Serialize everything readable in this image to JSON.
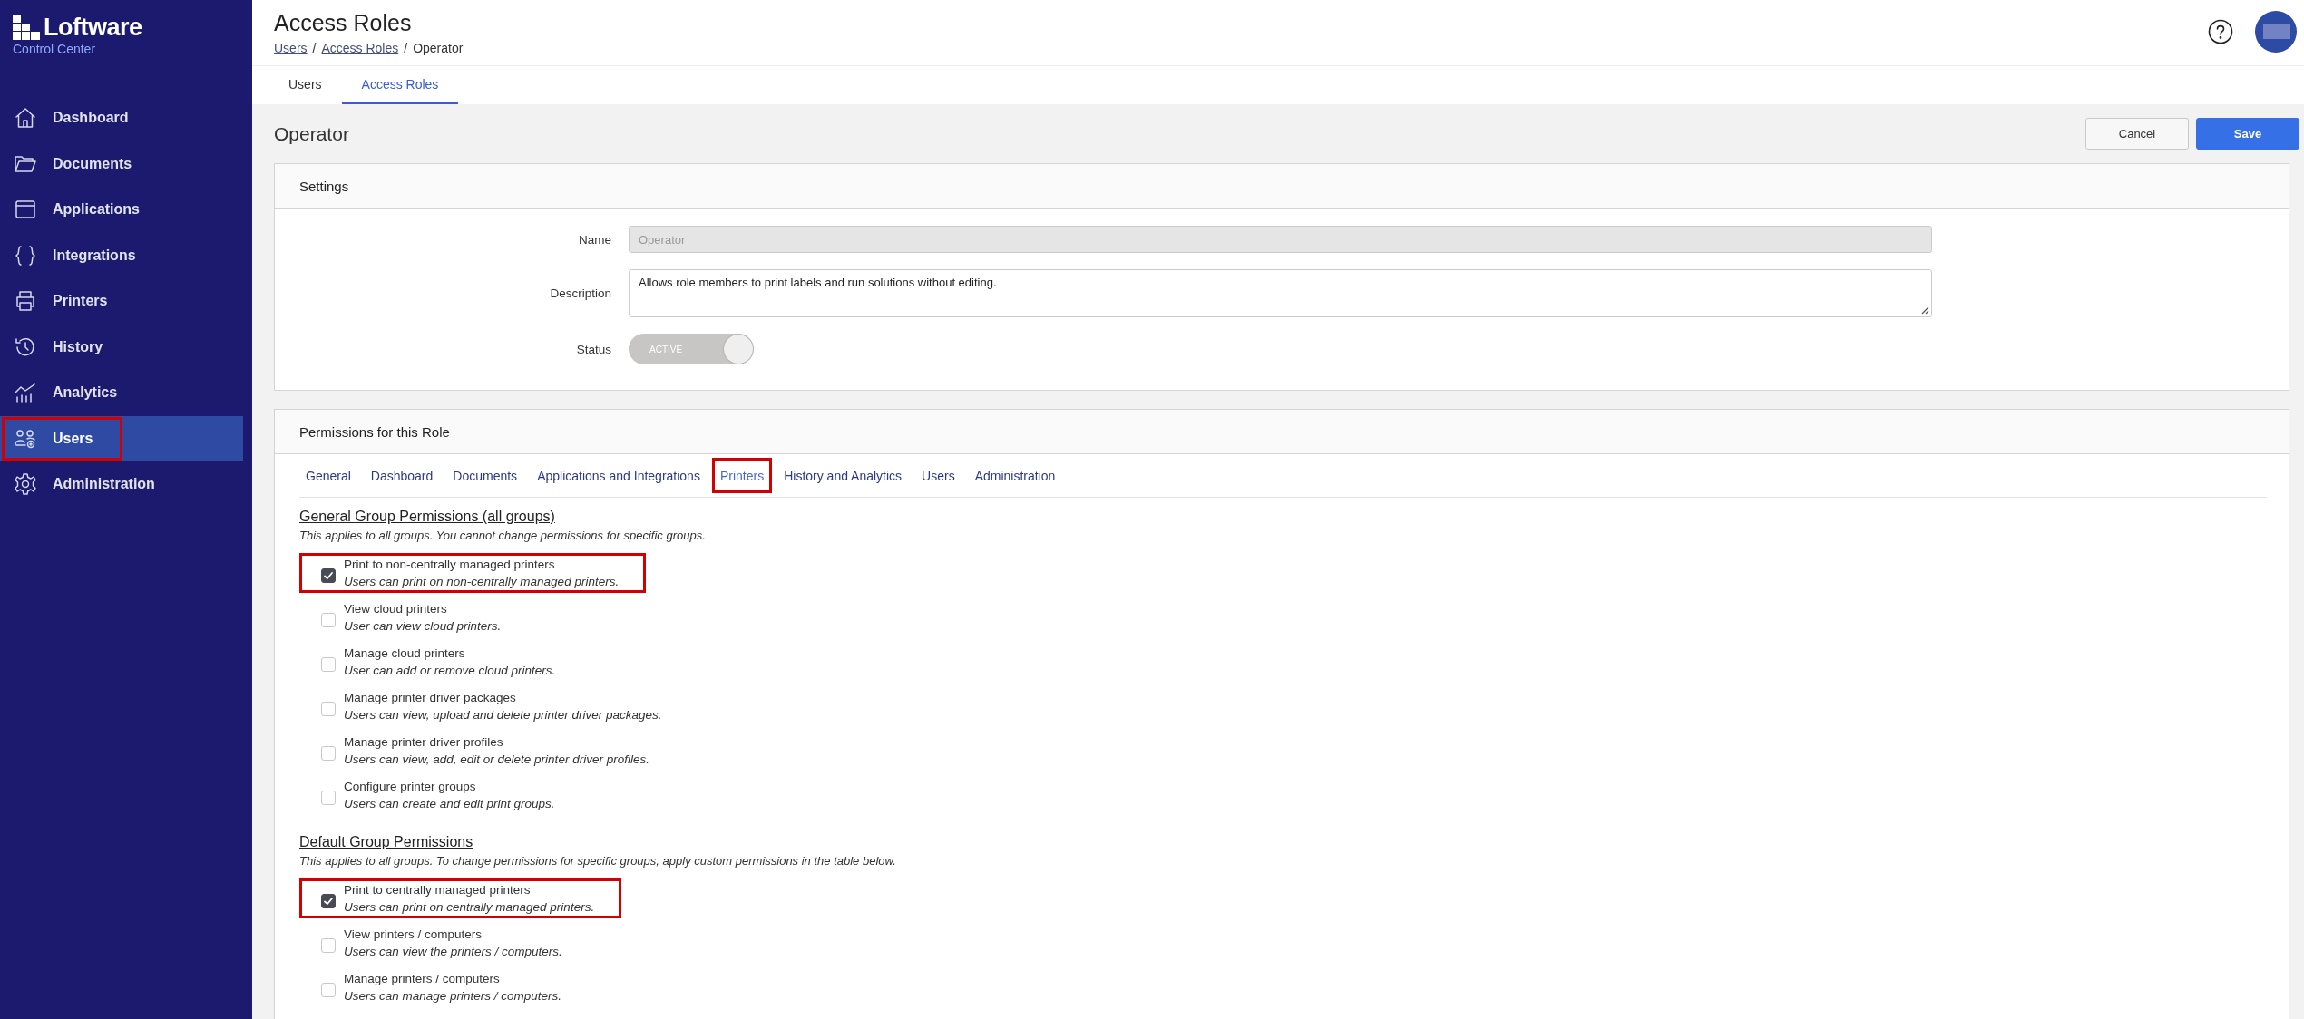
{
  "sidebar": {
    "logo": {
      "name": "Loftware",
      "subtitle": "Control Center"
    },
    "items": [
      {
        "label": "Dashboard",
        "selected": false,
        "highlighted": false
      },
      {
        "label": "Documents",
        "selected": false,
        "highlighted": false
      },
      {
        "label": "Applications",
        "selected": false,
        "highlighted": false
      },
      {
        "label": "Integrations",
        "selected": false,
        "highlighted": false
      },
      {
        "label": "Printers",
        "selected": false,
        "highlighted": false
      },
      {
        "label": "History",
        "selected": false,
        "highlighted": false
      },
      {
        "label": "Analytics",
        "selected": false,
        "highlighted": false
      },
      {
        "label": "Users",
        "selected": true,
        "highlighted": true
      },
      {
        "label": "Administration",
        "selected": false,
        "highlighted": false
      }
    ]
  },
  "header": {
    "title": "Access Roles",
    "breadcrumb": [
      {
        "label": "Users",
        "kind": "link"
      },
      {
        "label": "/",
        "kind": "separator"
      },
      {
        "label": "Access Roles",
        "kind": "link"
      },
      {
        "label": "/",
        "kind": "separator"
      },
      {
        "label": "Operator",
        "kind": "current"
      }
    ]
  },
  "tabs": [
    {
      "label": "Users",
      "selected": false
    },
    {
      "label": "Access Roles",
      "selected": true
    }
  ],
  "page": {
    "title": "Operator",
    "buttons": [
      {
        "label": "Cancel",
        "kind": "secondary"
      },
      {
        "label": "Save",
        "kind": "primary"
      }
    ]
  },
  "settings": {
    "title": "Settings",
    "fields": [
      {
        "kind": "input",
        "label": "Name",
        "value": "Operator",
        "disabled": true
      },
      {
        "kind": "textarea",
        "label": "Description",
        "value": "Allows role members to print labels and run solutions without editing."
      },
      {
        "kind": "toggle",
        "label": "Status",
        "text": "ACTIVE",
        "on": true
      }
    ]
  },
  "permissions": {
    "title": "Permissions for this Role",
    "tabs": [
      {
        "label": "General",
        "selected": false,
        "highlighted": false
      },
      {
        "label": "Dashboard",
        "selected": false,
        "highlighted": false
      },
      {
        "label": "Documents",
        "selected": false,
        "highlighted": false
      },
      {
        "label": "Applications and Integrations",
        "selected": false,
        "highlighted": false
      },
      {
        "label": "Printers",
        "selected": true,
        "highlighted": true
      },
      {
        "label": "History and Analytics",
        "selected": false,
        "highlighted": false
      },
      {
        "label": "Users",
        "selected": false,
        "highlighted": false
      },
      {
        "label": "Administration",
        "selected": false,
        "highlighted": false
      }
    ],
    "sections": [
      {
        "heading": "General Group Permissions (all groups)",
        "note": "This applies to all groups. You cannot change permissions for specific groups.",
        "items": [
          {
            "label": "Print to non-centrally managed printers",
            "description": "Users can print on non-centrally managed printers.",
            "checked": true,
            "highlighted": true
          },
          {
            "label": "View cloud printers",
            "description": "User can view cloud printers.",
            "checked": false,
            "highlighted": false
          },
          {
            "label": "Manage cloud printers",
            "description": "User can add or remove cloud printers.",
            "checked": false,
            "highlighted": false
          },
          {
            "label": "Manage printer driver packages",
            "description": "Users can view, upload and delete printer driver packages.",
            "checked": false,
            "highlighted": false
          },
          {
            "label": "Manage printer driver profiles",
            "description": "Users can view, add, edit or delete printer driver profiles.",
            "checked": false,
            "highlighted": false
          },
          {
            "label": "Configure printer groups",
            "description": "Users can create and edit print groups.",
            "checked": false,
            "highlighted": false
          }
        ]
      },
      {
        "heading": "Default Group Permissions",
        "note": "This applies to all groups. To change permissions for specific groups, apply custom permissions in the table below.",
        "items": [
          {
            "label": "Print to centrally managed printers",
            "description": "Users can print on centrally managed printers.",
            "checked": true,
            "highlighted": true
          },
          {
            "label": "View printers / computers",
            "description": "Users can view the printers / computers.",
            "checked": false,
            "highlighted": false
          },
          {
            "label": "Manage printers / computers",
            "description": "Users can manage printers / computers.",
            "checked": false,
            "highlighted": false
          }
        ]
      }
    ]
  }
}
